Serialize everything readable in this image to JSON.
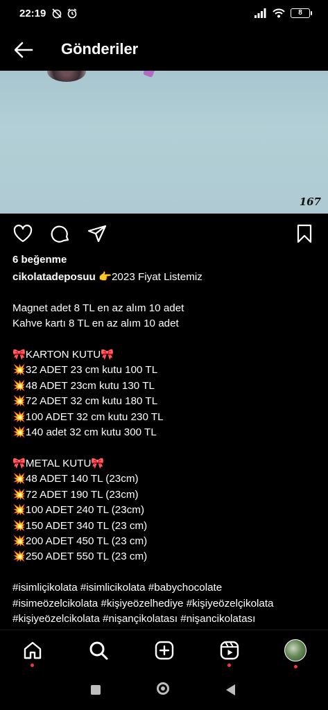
{
  "status_bar": {
    "time": "22:19",
    "left_icons": [
      "alarm-off-icon",
      "alarm-icon"
    ],
    "right_icons": [
      "signal-icon",
      "wifi-icon",
      "battery-icon"
    ],
    "battery": "8"
  },
  "header": {
    "title": "Gönderiler",
    "back_icon": "arrow-left-icon"
  },
  "post": {
    "image_counter": "167",
    "actions": [
      "heart-icon",
      "comment-icon",
      "share-icon",
      "bookmark-icon"
    ],
    "likes": "6 beğenme",
    "username": "cikolatadeposuu",
    "caption_first_line": " 👉2023 Fiyat Listemiz",
    "caption_body": "\nMagnet adet 8 TL en az alım 10 adet\nKahve kartı 8 TL en az alım 10 adet\n\n🎀KARTON KUTU🎀\n💥32 ADET 23 cm kutu 100 TL\n💥48 ADET 23cm kutu 130 TL\n💥72 ADET 32 cm kutu 180 TL\n💥100 ADET 32 cm kutu 230 TL\n💥140 adet 32 cm kutu 300 TL\n\n🎀METAL KUTU🎀\n💥48 ADET 140 TL (23cm)\n💥72 ADET 190 TL (23cm)\n💥100 ADET 240 TL (23cm)\n💥150 ADET 340 TL (23 cm)\n💥200 ADET 450 TL (23 cm)\n💥250 ADET 550 TL (23 cm)\n\n#isimliçikolata #isimlicikolata #babychocolate\n#isimeözelcikolata #kişiyeözelhediye #kişiyeözelçikolata\n#kişiyeözelcikolata #nişançikolatası #nişancikolatası"
  },
  "bottom_nav": {
    "items": [
      "home-icon",
      "search-icon",
      "new-post-icon",
      "reels-icon",
      "profile-avatar"
    ]
  },
  "system_nav": [
    "recents-button",
    "home-button",
    "back-button"
  ]
}
